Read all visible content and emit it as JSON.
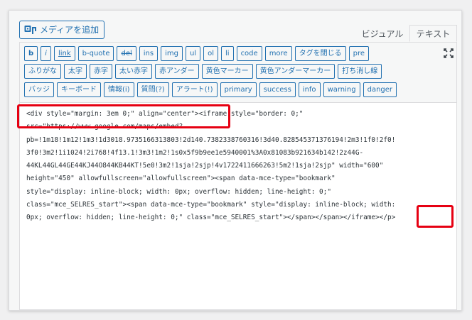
{
  "media_button": {
    "label": "メディアを追加",
    "icon": "media-add-icon"
  },
  "tabs": {
    "visual": "ビジュアル",
    "text": "テキスト"
  },
  "toolbar": {
    "row1": [
      "b",
      "i",
      "link",
      "b-quote",
      "del",
      "ins",
      "img",
      "ul",
      "ol",
      "li",
      "code",
      "more",
      "タグを閉じる",
      "pre"
    ],
    "row2": [
      "ふりがな",
      "太字",
      "赤字",
      "太い赤字",
      "赤アンダー",
      "黄色マーカー",
      "黄色アンダーマーカー",
      "打ち消し線"
    ],
    "row3": [
      "バッジ",
      "キーボード",
      "情報(i)",
      "質問(?)",
      "アラート(!)",
      "primary",
      "success",
      "info",
      "warning",
      "danger"
    ],
    "fullscreen_icon": "fullscreen-icon"
  },
  "editor": {
    "lines": [
      "<div style=\"margin: 3em 0;\" align=\"center\"><iframe style=\"border: 0;\"",
      "src=\"https://www.google.com/maps/embed?",
      "pb=!1m18!1m12!1m3!1d3018.9735166313803!2d140.7382338760316!3d40.828545371376194!2m3!1f0!2f0!",
      "3f0!3m2!1i1024!2i768!4f13.1!3m3!1m2!1s0x5f9b9ee1e5940001%3A0x81083b921634b142!2z44G-",
      "44KL44GL44GE44KJ44O844KB44KT!5e0!3m2!1sja!2sjp!4v1722411666263!5m2!1sja!2sjp\" width=\"600\"",
      "height=\"450\" allowfullscreen=\"allowfullscreen\"><span data-mce-type=\"bookmark\"",
      "style=\"display: inline-block; width: 0px; overflow: hidden; line-height: 0;\"",
      "class=\"mce_SELRES_start\"><span data-mce-type=\"bookmark\" style=\"display: inline-block; width:",
      "0px; overflow: hidden; line-height: 0;\" class=\"mce_SELRES_start\"></span></span></iframe></p>"
    ]
  },
  "highlight_color": "#e60012",
  "accent_color": "#2271b1"
}
